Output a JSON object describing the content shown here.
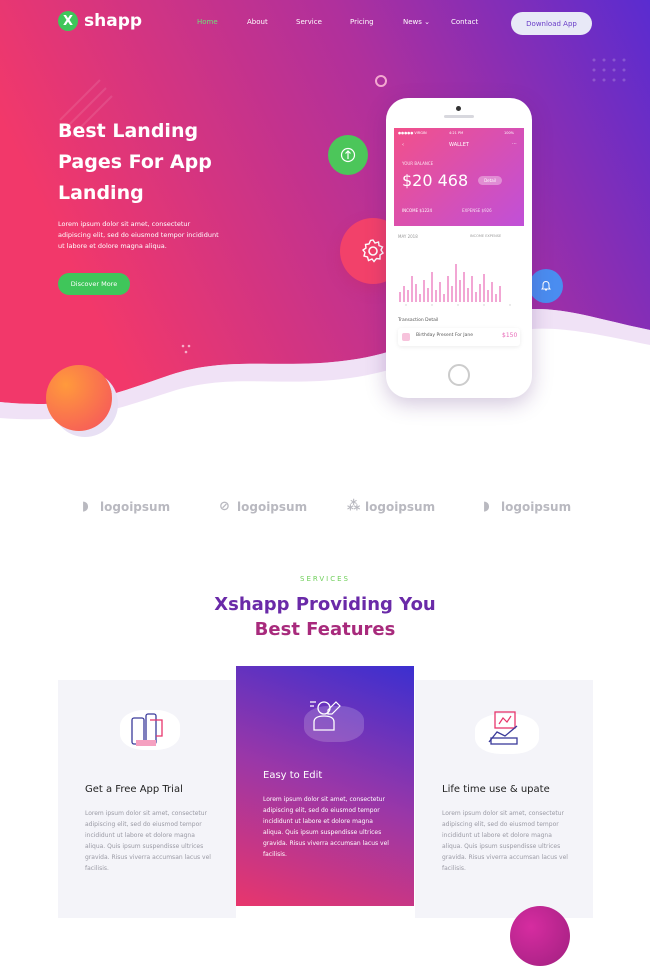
{
  "brand": {
    "mark": "X",
    "name": "shapp"
  },
  "nav": {
    "items": [
      "Home",
      "About",
      "Service",
      "Pricing",
      "News",
      "Contact"
    ],
    "news_caret": "⌄",
    "cta": "Download App"
  },
  "hero": {
    "title_line1": "Best Landing",
    "title_line2": "Pages For App",
    "title_line3": "Landing",
    "text": "Lorem ipsum dolor sit amet, consectetur adipiscing elit, sed do eiusmod tempor incididunt ut labore et dolore magna aliqua.",
    "button": "Discover More"
  },
  "phone": {
    "status_left": "●●●●● VIRGIN",
    "status_time": "4:21 PM",
    "status_right": "100%",
    "header": "WALLET",
    "balance_label": "YOUR BALANCE",
    "balance": "$20 468",
    "balance_badge": "Detail",
    "income": "INCOME $1224",
    "expense": "EXPENSE $926",
    "chart_left": "MAY 2018",
    "chart_right": "INCOME  EXPENSE",
    "transactions_label": "Transaction Detail",
    "transaction_name": "Birthday Present For Jane",
    "transaction_amount": "$150"
  },
  "partners": [
    "logoipsum",
    "logoipsum",
    "logoipsum",
    "logoipsum"
  ],
  "services": {
    "label": "SERVICES",
    "title_line1": "Xshapp Providing You",
    "title_line2": "Best Features",
    "cards": [
      {
        "title": "Get a Free App Trial",
        "text": "Lorem ipsum dolor sit amet, consectetur adipiscing elit, sed do eiusmod tempor incididunt ut labore et dolore magna aliqua. Quis ipsum suspendisse ultrices gravida. Risus viverra accumsan lacus vel facilisis."
      },
      {
        "title": "Easy to Edit",
        "text": "Lorem ipsum dolor sit amet, consectetur adipiscing elit, sed do eiusmod tempor incididunt ut labore et dolore magna aliqua. Quis ipsum suspendisse ultrices gravida. Risus viverra accumsan lacus vel facilisis."
      },
      {
        "title": "Life time use & upate",
        "text": "Lorem ipsum dolor sit amet, consectetur adipiscing elit, sed do eiusmod tempor incididunt ut labore et dolore magna aliqua. Quis ipsum suspendisse ultrices gravida. Risus viverra accumsan lacus vel facilisis."
      }
    ]
  },
  "colors": {
    "accent_green": "#3fc65a",
    "hero_pink": "#f2386a",
    "hero_purple": "#8a2ec0",
    "brand_purple": "#6a2aa8"
  }
}
